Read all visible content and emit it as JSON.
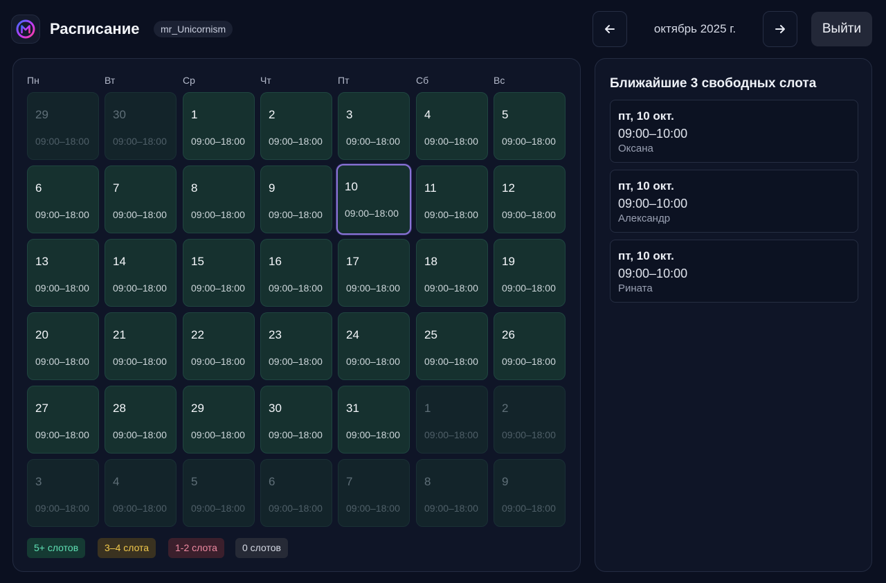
{
  "header": {
    "title": "Расписание",
    "user": "mr_Unicornism",
    "month": "октябрь 2025 г.",
    "prev_icon": "arrow-left-icon",
    "next_icon": "arrow-right-icon",
    "logout_label": "Выйти",
    "logo_letter": "M"
  },
  "weekdays": [
    "Пн",
    "Вт",
    "Ср",
    "Чт",
    "Пт",
    "Сб",
    "Вс"
  ],
  "days": [
    {
      "num": "29",
      "time": "09:00–18:00",
      "outside": true
    },
    {
      "num": "30",
      "time": "09:00–18:00",
      "outside": true
    },
    {
      "num": "1",
      "time": "09:00–18:00"
    },
    {
      "num": "2",
      "time": "09:00–18:00"
    },
    {
      "num": "3",
      "time": "09:00–18:00"
    },
    {
      "num": "4",
      "time": "09:00–18:00"
    },
    {
      "num": "5",
      "time": "09:00–18:00"
    },
    {
      "num": "6",
      "time": "09:00–18:00"
    },
    {
      "num": "7",
      "time": "09:00–18:00"
    },
    {
      "num": "8",
      "time": "09:00–18:00"
    },
    {
      "num": "9",
      "time": "09:00–18:00"
    },
    {
      "num": "10",
      "time": "09:00–18:00",
      "today": true
    },
    {
      "num": "11",
      "time": "09:00–18:00"
    },
    {
      "num": "12",
      "time": "09:00–18:00"
    },
    {
      "num": "13",
      "time": "09:00–18:00"
    },
    {
      "num": "14",
      "time": "09:00–18:00"
    },
    {
      "num": "15",
      "time": "09:00–18:00"
    },
    {
      "num": "16",
      "time": "09:00–18:00"
    },
    {
      "num": "17",
      "time": "09:00–18:00"
    },
    {
      "num": "18",
      "time": "09:00–18:00"
    },
    {
      "num": "19",
      "time": "09:00–18:00"
    },
    {
      "num": "20",
      "time": "09:00–18:00"
    },
    {
      "num": "21",
      "time": "09:00–18:00"
    },
    {
      "num": "22",
      "time": "09:00–18:00"
    },
    {
      "num": "23",
      "time": "09:00–18:00"
    },
    {
      "num": "24",
      "time": "09:00–18:00"
    },
    {
      "num": "25",
      "time": "09:00–18:00"
    },
    {
      "num": "26",
      "time": "09:00–18:00"
    },
    {
      "num": "27",
      "time": "09:00–18:00"
    },
    {
      "num": "28",
      "time": "09:00–18:00"
    },
    {
      "num": "29",
      "time": "09:00–18:00"
    },
    {
      "num": "30",
      "time": "09:00–18:00"
    },
    {
      "num": "31",
      "time": "09:00–18:00"
    },
    {
      "num": "1",
      "time": "09:00–18:00",
      "outside": true
    },
    {
      "num": "2",
      "time": "09:00–18:00",
      "outside": true
    },
    {
      "num": "3",
      "time": "09:00–18:00",
      "outside": true
    },
    {
      "num": "4",
      "time": "09:00–18:00",
      "outside": true
    },
    {
      "num": "5",
      "time": "09:00–18:00",
      "outside": true
    },
    {
      "num": "6",
      "time": "09:00–18:00",
      "outside": true
    },
    {
      "num": "7",
      "time": "09:00–18:00",
      "outside": true
    },
    {
      "num": "8",
      "time": "09:00–18:00",
      "outside": true
    },
    {
      "num": "9",
      "time": "09:00–18:00",
      "outside": true
    }
  ],
  "legend": {
    "green": "5+ слотов",
    "yellow": "3–4 слота",
    "red": "1-2 слота",
    "gray": "0 слотов"
  },
  "side": {
    "title": "Ближайшие 3 свободных слота",
    "slots": [
      {
        "date": "пт, 10 окт.",
        "time": "09:00–10:00",
        "person": "Оксана"
      },
      {
        "date": "пт, 10 окт.",
        "time": "09:00–10:00",
        "person": "Александр"
      },
      {
        "date": "пт, 10 окт.",
        "time": "09:00–10:00",
        "person": "Рината"
      }
    ]
  },
  "colors": {
    "accent": "#8a74d6",
    "day_bg": "#16312f",
    "background": "#0b1020"
  }
}
